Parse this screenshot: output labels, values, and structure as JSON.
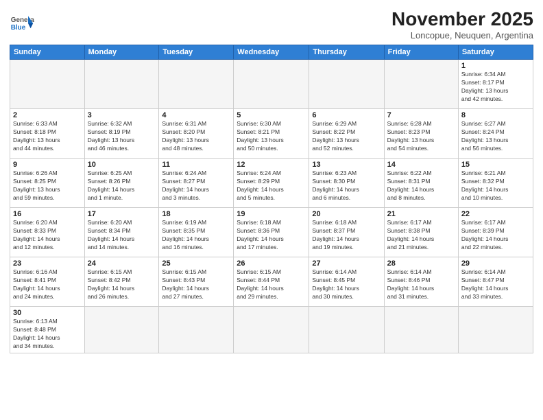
{
  "logo": {
    "general": "General",
    "blue": "Blue"
  },
  "title": "November 2025",
  "subtitle": "Loncopue, Neuquen, Argentina",
  "days_header": [
    "Sunday",
    "Monday",
    "Tuesday",
    "Wednesday",
    "Thursday",
    "Friday",
    "Saturday"
  ],
  "weeks": [
    [
      {
        "day": "",
        "info": ""
      },
      {
        "day": "",
        "info": ""
      },
      {
        "day": "",
        "info": ""
      },
      {
        "day": "",
        "info": ""
      },
      {
        "day": "",
        "info": ""
      },
      {
        "day": "",
        "info": ""
      },
      {
        "day": "1",
        "info": "Sunrise: 6:34 AM\nSunset: 8:17 PM\nDaylight: 13 hours\nand 42 minutes."
      }
    ],
    [
      {
        "day": "2",
        "info": "Sunrise: 6:33 AM\nSunset: 8:18 PM\nDaylight: 13 hours\nand 44 minutes."
      },
      {
        "day": "3",
        "info": "Sunrise: 6:32 AM\nSunset: 8:19 PM\nDaylight: 13 hours\nand 46 minutes."
      },
      {
        "day": "4",
        "info": "Sunrise: 6:31 AM\nSunset: 8:20 PM\nDaylight: 13 hours\nand 48 minutes."
      },
      {
        "day": "5",
        "info": "Sunrise: 6:30 AM\nSunset: 8:21 PM\nDaylight: 13 hours\nand 50 minutes."
      },
      {
        "day": "6",
        "info": "Sunrise: 6:29 AM\nSunset: 8:22 PM\nDaylight: 13 hours\nand 52 minutes."
      },
      {
        "day": "7",
        "info": "Sunrise: 6:28 AM\nSunset: 8:23 PM\nDaylight: 13 hours\nand 54 minutes."
      },
      {
        "day": "8",
        "info": "Sunrise: 6:27 AM\nSunset: 8:24 PM\nDaylight: 13 hours\nand 56 minutes."
      }
    ],
    [
      {
        "day": "9",
        "info": "Sunrise: 6:26 AM\nSunset: 8:25 PM\nDaylight: 13 hours\nand 59 minutes."
      },
      {
        "day": "10",
        "info": "Sunrise: 6:25 AM\nSunset: 8:26 PM\nDaylight: 14 hours\nand 1 minute."
      },
      {
        "day": "11",
        "info": "Sunrise: 6:24 AM\nSunset: 8:27 PM\nDaylight: 14 hours\nand 3 minutes."
      },
      {
        "day": "12",
        "info": "Sunrise: 6:24 AM\nSunset: 8:29 PM\nDaylight: 14 hours\nand 5 minutes."
      },
      {
        "day": "13",
        "info": "Sunrise: 6:23 AM\nSunset: 8:30 PM\nDaylight: 14 hours\nand 6 minutes."
      },
      {
        "day": "14",
        "info": "Sunrise: 6:22 AM\nSunset: 8:31 PM\nDaylight: 14 hours\nand 8 minutes."
      },
      {
        "day": "15",
        "info": "Sunrise: 6:21 AM\nSunset: 8:32 PM\nDaylight: 14 hours\nand 10 minutes."
      }
    ],
    [
      {
        "day": "16",
        "info": "Sunrise: 6:20 AM\nSunset: 8:33 PM\nDaylight: 14 hours\nand 12 minutes."
      },
      {
        "day": "17",
        "info": "Sunrise: 6:20 AM\nSunset: 8:34 PM\nDaylight: 14 hours\nand 14 minutes."
      },
      {
        "day": "18",
        "info": "Sunrise: 6:19 AM\nSunset: 8:35 PM\nDaylight: 14 hours\nand 16 minutes."
      },
      {
        "day": "19",
        "info": "Sunrise: 6:18 AM\nSunset: 8:36 PM\nDaylight: 14 hours\nand 17 minutes."
      },
      {
        "day": "20",
        "info": "Sunrise: 6:18 AM\nSunset: 8:37 PM\nDaylight: 14 hours\nand 19 minutes."
      },
      {
        "day": "21",
        "info": "Sunrise: 6:17 AM\nSunset: 8:38 PM\nDaylight: 14 hours\nand 21 minutes."
      },
      {
        "day": "22",
        "info": "Sunrise: 6:17 AM\nSunset: 8:39 PM\nDaylight: 14 hours\nand 22 minutes."
      }
    ],
    [
      {
        "day": "23",
        "info": "Sunrise: 6:16 AM\nSunset: 8:41 PM\nDaylight: 14 hours\nand 24 minutes."
      },
      {
        "day": "24",
        "info": "Sunrise: 6:15 AM\nSunset: 8:42 PM\nDaylight: 14 hours\nand 26 minutes."
      },
      {
        "day": "25",
        "info": "Sunrise: 6:15 AM\nSunset: 8:43 PM\nDaylight: 14 hours\nand 27 minutes."
      },
      {
        "day": "26",
        "info": "Sunrise: 6:15 AM\nSunset: 8:44 PM\nDaylight: 14 hours\nand 29 minutes."
      },
      {
        "day": "27",
        "info": "Sunrise: 6:14 AM\nSunset: 8:45 PM\nDaylight: 14 hours\nand 30 minutes."
      },
      {
        "day": "28",
        "info": "Sunrise: 6:14 AM\nSunset: 8:46 PM\nDaylight: 14 hours\nand 31 minutes."
      },
      {
        "day": "29",
        "info": "Sunrise: 6:14 AM\nSunset: 8:47 PM\nDaylight: 14 hours\nand 33 minutes."
      }
    ],
    [
      {
        "day": "30",
        "info": "Sunrise: 6:13 AM\nSunset: 8:48 PM\nDaylight: 14 hours\nand 34 minutes."
      },
      {
        "day": "",
        "info": ""
      },
      {
        "day": "",
        "info": ""
      },
      {
        "day": "",
        "info": ""
      },
      {
        "day": "",
        "info": ""
      },
      {
        "day": "",
        "info": ""
      },
      {
        "day": "",
        "info": ""
      }
    ]
  ]
}
